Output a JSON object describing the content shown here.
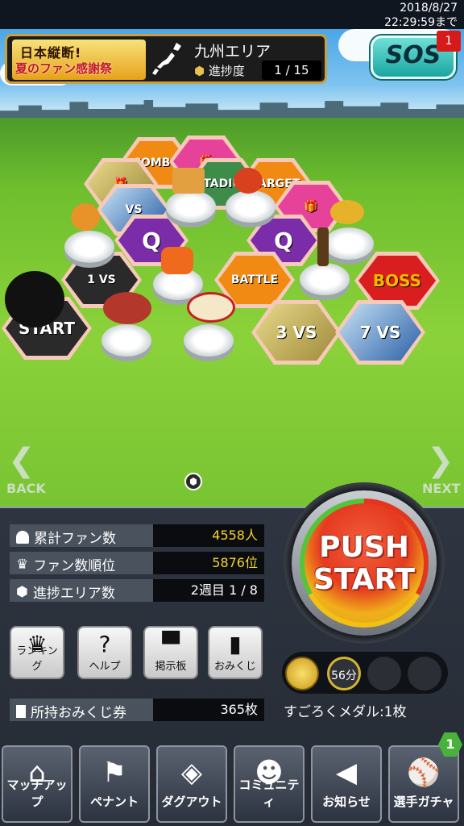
{
  "status": {
    "date": "2018/8/27",
    "deadline": "22:29:59まで"
  },
  "event": {
    "title_line1": "日本縦断!",
    "title_line2": "夏のファン感謝祭",
    "area_name": "九州エリア",
    "progress_label": "進捗度",
    "progress_value": "1 / 15"
  },
  "sos": {
    "label": "SOS",
    "badge": "1"
  },
  "board": {
    "tiles": [
      "COMBO",
      "STADIUM",
      "TARGET",
      "VS",
      "Q",
      "Q",
      "VS",
      "BATTLE",
      "BOSS",
      "VS",
      "VS",
      "START"
    ],
    "tile_numbers": [
      "1",
      "3",
      "7"
    ]
  },
  "nav": {
    "back": "BACK",
    "next": "NEXT"
  },
  "stats": [
    {
      "label": "累計ファン数",
      "value": "4558人",
      "color": "#f5d428"
    },
    {
      "label": "ファン数順位",
      "value": "5876位",
      "color": "#f5d428"
    },
    {
      "label": "進捗エリア数",
      "value": "2週目 1 / 8",
      "color": "#ffffff"
    }
  ],
  "buttons": [
    {
      "label": "ランキング",
      "icon": "crown-icon"
    },
    {
      "label": "ヘルプ",
      "icon": "question-icon"
    },
    {
      "label": "掲示板",
      "icon": "board-icon"
    },
    {
      "label": "おみくじ",
      "icon": "omikuji-icon"
    }
  ],
  "push": {
    "line1": "PUSH",
    "line2": "START"
  },
  "medals": {
    "time": "56分",
    "label": "すごろくメダル:1枚"
  },
  "ticket": {
    "label": "所持おみくじ券",
    "value": "365枚"
  },
  "tabs": [
    {
      "label": "マッチアップ",
      "icon": "japan-map-icon"
    },
    {
      "label": "ペナント",
      "icon": "pennant-icon"
    },
    {
      "label": "ダグアウト",
      "icon": "dugout-icon"
    },
    {
      "label": "コミュニティ",
      "icon": "community-icon"
    },
    {
      "label": "お知らせ",
      "icon": "megaphone-icon"
    },
    {
      "label": "選手ガチャ",
      "icon": "gacha-player-icon"
    }
  ],
  "tab_badge": "1"
}
